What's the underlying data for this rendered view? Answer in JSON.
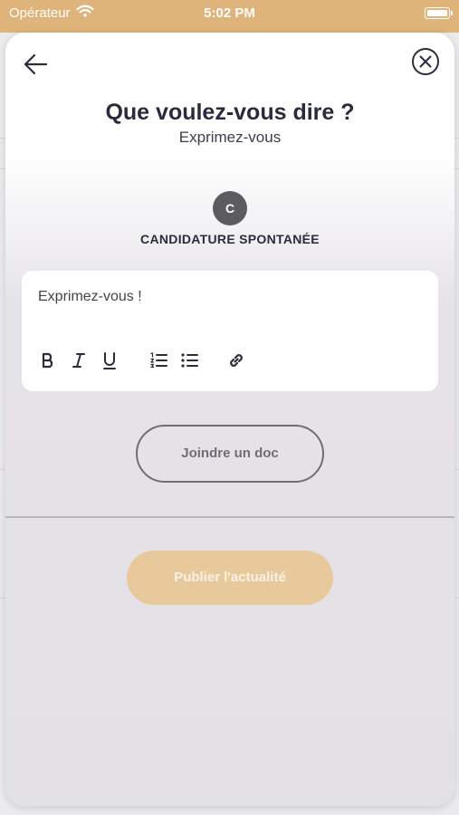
{
  "status_bar": {
    "carrier": "Opérateur",
    "time": "5:02 PM"
  },
  "sheet": {
    "title": "Que voulez-vous dire ?",
    "subtitle": "Exprimez-vous",
    "avatar_initial": "C",
    "category": "CANDIDATURE SPONTANÉE",
    "editor": {
      "placeholder": "Exprimez-vous !",
      "toolbar": [
        "bold-icon",
        "italic-icon",
        "underline-icon",
        "ordered-list-icon",
        "bullet-list-icon",
        "link-icon"
      ]
    },
    "attach_label": "Joindre un doc",
    "publish_label": "Publier l'actualité"
  },
  "colors": {
    "accent": "#dfb47b",
    "publish_button": "#e8c99c",
    "avatar": "#5c5c60"
  }
}
